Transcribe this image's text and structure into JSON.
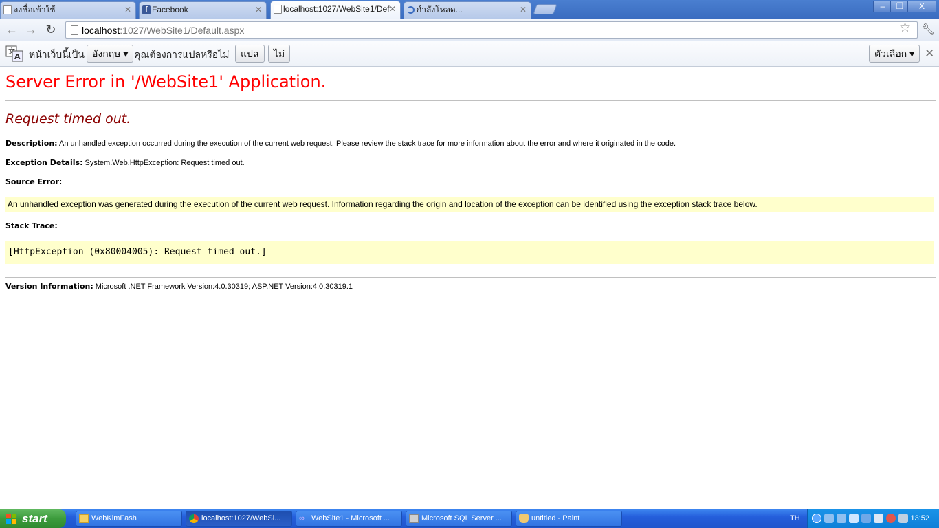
{
  "tabs": [
    {
      "title": "ลงชื่อเข้าใช้",
      "icon": "page-icon"
    },
    {
      "title": "Facebook",
      "icon": "facebook-icon"
    },
    {
      "title": "localhost:1027/WebSite1/Def",
      "icon": "page-icon"
    },
    {
      "title": "กำลังโหลด...",
      "icon": "loading-spinner-icon"
    }
  ],
  "window_controls": {
    "minimize": "–",
    "restore": "❐",
    "close": "X"
  },
  "toolbar": {
    "back_icon": "back-arrow-icon",
    "forward_icon": "forward-arrow-icon",
    "reload_icon": "reload-icon",
    "url_host": "localhost",
    "url_rest": ":1027/WebSite1/Default.aspx",
    "star_icon": "star-icon",
    "wrench_icon": "wrench-icon"
  },
  "translate_bar": {
    "page_is_in": "หน้าเว็บนี้เป็น",
    "language": "อังกฤษ ▾",
    "question": "คุณต้องการแปลหรือไม่",
    "translate_button": "แปล",
    "no_button": "ไม่",
    "options_button": "ตัวเลือก ▾",
    "close": "✕"
  },
  "error_page": {
    "title": "Server Error in '/WebSite1' Application.",
    "message": "Request timed out.",
    "description_label": "Description:",
    "description_text": " An unhandled exception occurred during the execution of the current web request. Please review the stack trace for more information about the error and where it originated in the code.",
    "exception_label": "Exception Details:",
    "exception_text": " System.Web.HttpException: Request timed out.",
    "source_error_label": "Source Error:",
    "source_error_text": "An unhandled exception was generated during the execution of the current web request. Information regarding the origin and location of the exception can be identified using the exception stack trace below.",
    "stack_trace_label": "Stack Trace:",
    "stack_trace_text": "[HttpException (0x80004005): Request timed out.]",
    "version_label": "Version Information:",
    "version_text": " Microsoft .NET Framework Version:4.0.30319; ASP.NET Version:4.0.30319.1"
  },
  "taskbar": {
    "start_label": "start",
    "tasks": [
      {
        "label": "WebKimFash",
        "icon": "folder-icon"
      },
      {
        "label": "localhost:1027/WebSi...",
        "icon": "chrome-icon"
      },
      {
        "label": "WebSite1 - Microsoft ...",
        "icon": "visual-studio-icon"
      },
      {
        "label": "Microsoft SQL Server ...",
        "icon": "sql-server-icon"
      },
      {
        "label": "untitled - Paint",
        "icon": "paint-icon"
      }
    ],
    "language": "TH",
    "clock": "13:52"
  }
}
